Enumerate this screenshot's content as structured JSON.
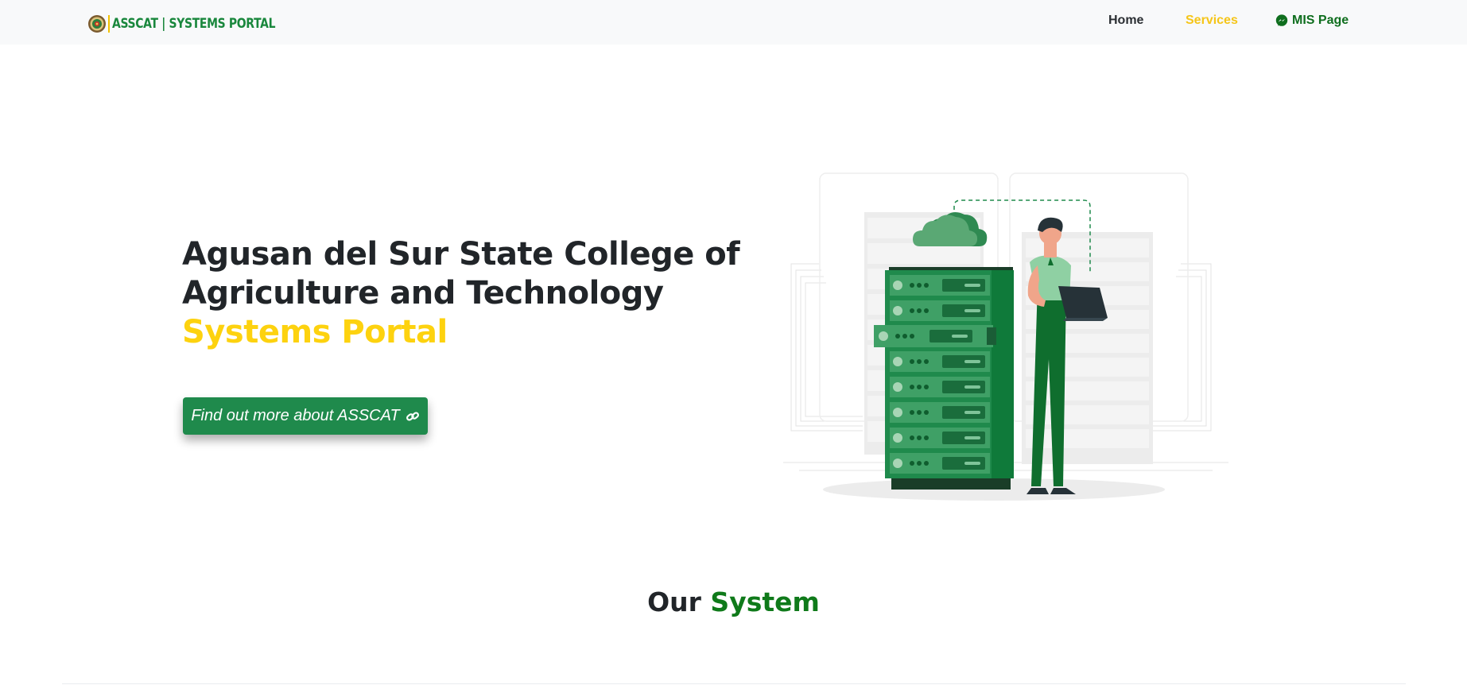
{
  "navbar": {
    "brand": "ASSCAT | SYSTEMS PORTAL",
    "links": {
      "home": "Home",
      "services": "Services",
      "mis": "MIS Page"
    }
  },
  "hero": {
    "title_line1": "Agusan del Sur State College of",
    "title_line2": "Agriculture and Technology",
    "title_accent": "Systems Portal",
    "cta_label": "Find out more about ASSCAT"
  },
  "section": {
    "title_part1": "Our",
    "title_part2": "System"
  },
  "colors": {
    "brand_green": "#19873c",
    "accent_yellow": "#fdd20f",
    "button_green": "#1f8a4c",
    "navbar_bg": "#f8f9fa"
  },
  "icons": {
    "brand_seal": "college-seal-icon",
    "mis": "messenger-icon",
    "cta": "link-icon"
  }
}
